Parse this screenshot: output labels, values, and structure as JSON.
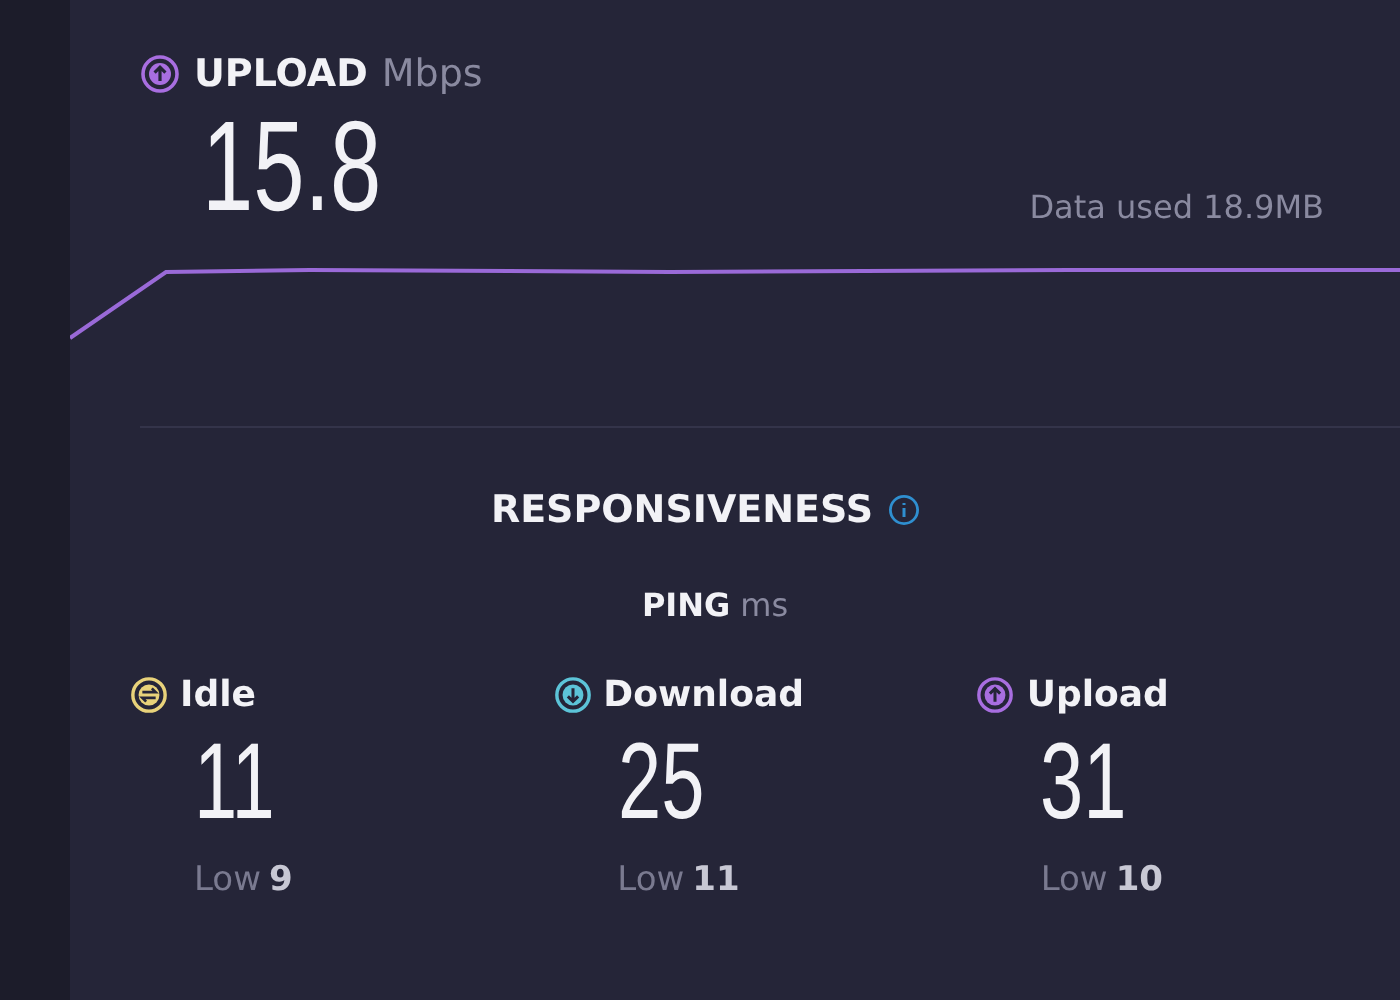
{
  "upload": {
    "label": "UPLOAD",
    "unit": "Mbps",
    "value": "15.8",
    "data_used": "Data used 18.9MB"
  },
  "responsiveness": {
    "title": "RESPONSIVENESS",
    "ping_label": "PING",
    "ping_unit": "ms",
    "metrics": [
      {
        "kind": "idle",
        "color": "#e8d27a",
        "label": "Idle",
        "value": "11",
        "low_label": "Low",
        "low_value": "9"
      },
      {
        "kind": "download",
        "color": "#5cc4d8",
        "label": "Download",
        "value": "25",
        "low_label": "Low",
        "low_value": "11"
      },
      {
        "kind": "upload",
        "color": "#a86ee0",
        "label": "Upload",
        "value": "31",
        "low_label": "Low",
        "low_value": "10"
      }
    ]
  }
}
